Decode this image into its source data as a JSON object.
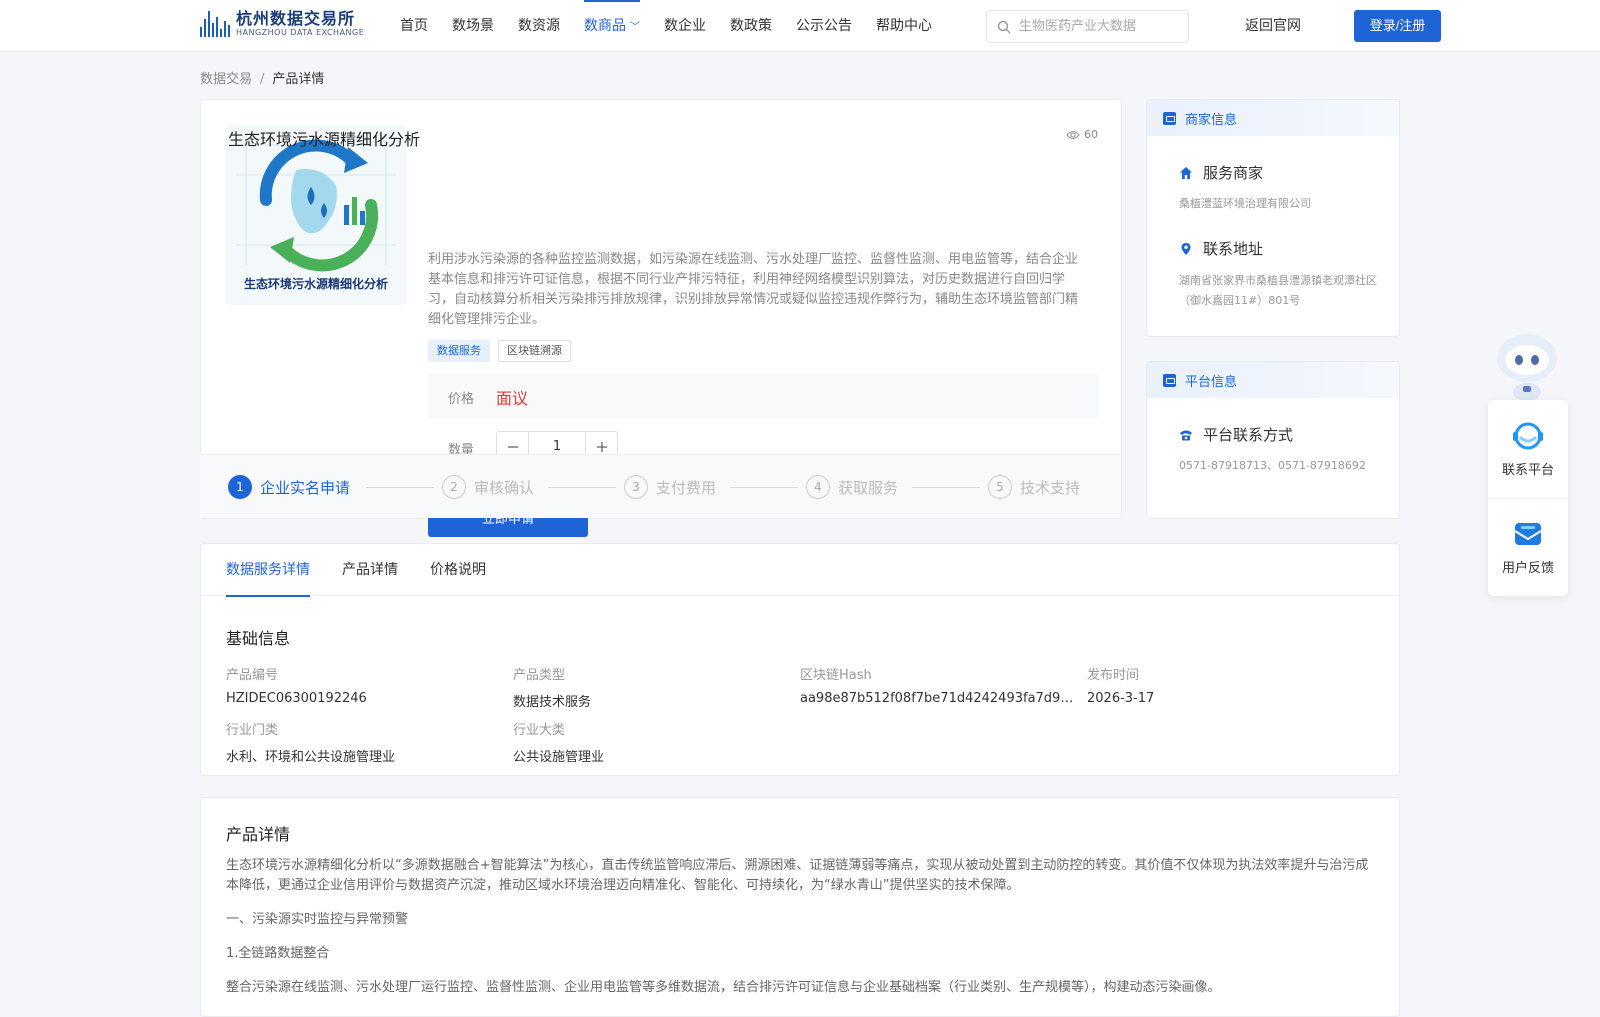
{
  "header": {
    "logo_cn": "杭州数据交易所",
    "logo_en": "HANGZHOU DATA EXCHANGE",
    "nav": [
      "首页",
      "数场景",
      "数资源",
      "数商品",
      "数企业",
      "数政策",
      "公示公告",
      "帮助中心"
    ],
    "active_nav": "数商品",
    "search_placeholder": "生物医药产业大数据",
    "back_link": "返回官网",
    "login_label": "登录/注册"
  },
  "breadcrumb": {
    "root": "数据交易",
    "sep": "/",
    "current": "产品详情"
  },
  "product": {
    "image_caption": "生态环境污水源精细化分析",
    "title": "生态环境污水源精细化分析",
    "views": "60",
    "description": "利用涉水污染源的各种监控监测数据，如污染源在线监测、污水处理厂监控、监督性监测、用电监管等，结合企业基本信息和排污许可证信息，根据不同行业产排污特征，利用神经网络模型识别算法，对历史数据进行自回归学习，自动核算分析相关污染排污排放规律，识别排放异常情况或疑似监控违规作弊行为，辅助生态环境监管部门精细化管理排污企业。",
    "tags": [
      "数据服务",
      "区块链溯源"
    ],
    "price_label": "价格",
    "price_value": "面议",
    "qty_label": "数量",
    "qty_value": "1",
    "apply_label": "立即申请"
  },
  "steps": [
    {
      "num": "1",
      "label": "企业实名申请"
    },
    {
      "num": "2",
      "label": "审核确认"
    },
    {
      "num": "3",
      "label": "支付费用"
    },
    {
      "num": "4",
      "label": "获取服务"
    },
    {
      "num": "5",
      "label": "技术支持"
    }
  ],
  "merchant": {
    "header": "商家信息",
    "service_title": "服务商家",
    "service_value": "桑植澧蓝环境治理有限公司",
    "address_title": "联系地址",
    "address_value": "湖南省张家界市桑植县澧源镇老观潭社区（御水嘉园11#）801号"
  },
  "platform": {
    "header": "平台信息",
    "contact_title": "平台联系方式",
    "contact_value": "0571-87918713、0571-87918692"
  },
  "floating": {
    "contact": "联系平台",
    "feedback": "用户反馈"
  },
  "tabs": [
    "数据服务详情",
    "产品详情",
    "价格说明"
  ],
  "basic": {
    "title": "基础信息",
    "fields": [
      {
        "k": "产品编号",
        "v": "HZIDEC06300192246"
      },
      {
        "k": "产品类型",
        "v": "数据技术服务"
      },
      {
        "k": "区块链Hash",
        "v": "aa98e87b512f08f7be71d4242493fa7d9ba…"
      },
      {
        "k": "发布时间",
        "v": "2026-3-17"
      },
      {
        "k": "行业门类",
        "v": "水利、环境和公共设施管理业"
      },
      {
        "k": "行业大类",
        "v": "公共设施管理业"
      }
    ]
  },
  "detail": {
    "title": "产品详情",
    "para1": "生态环境污水源精细化分析以“多源数据融合+智能算法”为核心，直击传统监管响应滞后、溯源困难、证据链薄弱等痛点，实现从被动处置到主动防控的转变。其价值不仅体现为执法效率提升与治污成本降低，更通过企业信用评价与数据资产沉淀，推动区域水环境治理迈向精准化、智能化、可持续化，为“绿水青山”提供坚实的技术保障。",
    "h1": "一、污染源实时监控与异常预警",
    "h2": "1.全链路数据整合",
    "para2": "整合污染源在线监测、污水处理厂运行监控、监督性监测、企业用电监管等多维数据流，结合排污许可证信息与企业基础档案（行业类别、生产规模等），构建动态污染画像。"
  }
}
